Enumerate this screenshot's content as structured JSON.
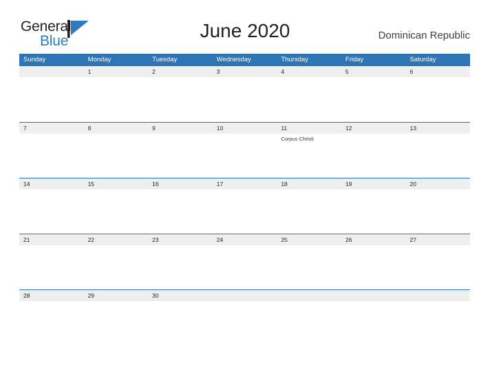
{
  "brand": {
    "name_part1": "General",
    "name_part2": "Blue",
    "flag_icon": "flag-triangle-icon",
    "accent_color": "#2b7bbd"
  },
  "header": {
    "title": "June 2020",
    "country": "Dominican Republic"
  },
  "colors": {
    "header_blue": "#2e75b6",
    "day_band_gray": "#efefef",
    "text_dark": "#231f20"
  },
  "weekdays": [
    "Sunday",
    "Monday",
    "Tuesday",
    "Wednesday",
    "Thursday",
    "Friday",
    "Saturday"
  ],
  "weeks": [
    [
      {
        "day": "",
        "events": []
      },
      {
        "day": "1",
        "events": []
      },
      {
        "day": "2",
        "events": []
      },
      {
        "day": "3",
        "events": []
      },
      {
        "day": "4",
        "events": []
      },
      {
        "day": "5",
        "events": []
      },
      {
        "day": "6",
        "events": []
      }
    ],
    [
      {
        "day": "7",
        "events": []
      },
      {
        "day": "8",
        "events": []
      },
      {
        "day": "9",
        "events": []
      },
      {
        "day": "10",
        "events": []
      },
      {
        "day": "11",
        "events": [
          "Corpus Christi"
        ]
      },
      {
        "day": "12",
        "events": []
      },
      {
        "day": "13",
        "events": []
      }
    ],
    [
      {
        "day": "14",
        "events": []
      },
      {
        "day": "15",
        "events": []
      },
      {
        "day": "16",
        "events": []
      },
      {
        "day": "17",
        "events": []
      },
      {
        "day": "18",
        "events": []
      },
      {
        "day": "19",
        "events": []
      },
      {
        "day": "20",
        "events": []
      }
    ],
    [
      {
        "day": "21",
        "events": []
      },
      {
        "day": "22",
        "events": []
      },
      {
        "day": "23",
        "events": []
      },
      {
        "day": "24",
        "events": []
      },
      {
        "day": "25",
        "events": []
      },
      {
        "day": "26",
        "events": []
      },
      {
        "day": "27",
        "events": []
      }
    ],
    [
      {
        "day": "28",
        "events": []
      },
      {
        "day": "29",
        "events": []
      },
      {
        "day": "30",
        "events": []
      },
      {
        "day": "",
        "events": []
      },
      {
        "day": "",
        "events": []
      },
      {
        "day": "",
        "events": []
      },
      {
        "day": "",
        "events": []
      }
    ]
  ]
}
